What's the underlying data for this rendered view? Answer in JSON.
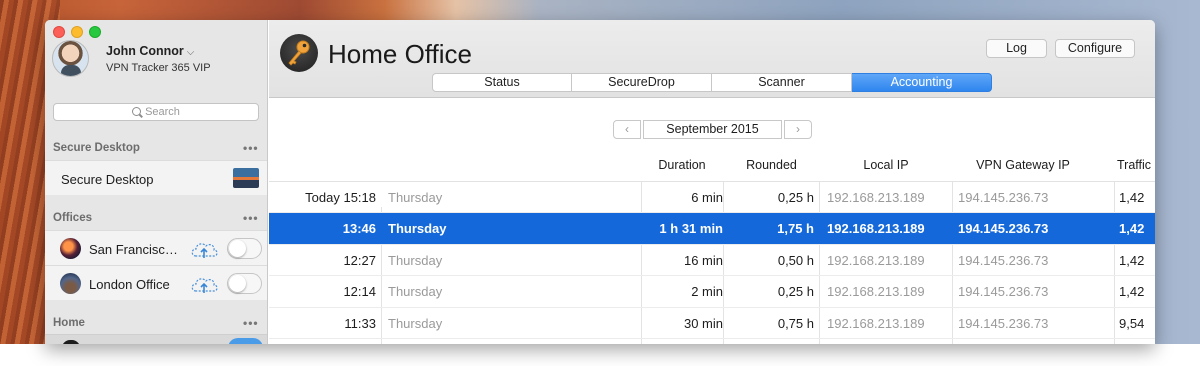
{
  "user": {
    "name": "John Connor",
    "plan": "VPN Tracker 365 VIP"
  },
  "search": {
    "placeholder": "Search"
  },
  "sidebar": {
    "sections": [
      {
        "title": "Secure Desktop",
        "more": "•••",
        "items": [
          {
            "label": "Secure Desktop"
          }
        ]
      },
      {
        "title": "Offices",
        "more": "•••",
        "items": [
          {
            "label": "San Francisc…"
          },
          {
            "label": "London Office"
          }
        ]
      },
      {
        "title": "Home",
        "more": "•••",
        "items": []
      }
    ]
  },
  "app": {
    "title": "Home Office"
  },
  "toolbar": {
    "log_label": "Log",
    "configure_label": "Configure"
  },
  "tabs": [
    {
      "label": "Status",
      "active": false
    },
    {
      "label": "SecureDrop",
      "active": false
    },
    {
      "label": "Scanner",
      "active": false
    },
    {
      "label": "Accounting",
      "active": true
    }
  ],
  "month_nav": {
    "prev": "‹",
    "label": "September 2015",
    "next": "›"
  },
  "table": {
    "columns": [
      "Duration",
      "Rounded",
      "Local IP",
      "VPN Gateway IP",
      "Traffic"
    ],
    "rows": [
      {
        "time": "Today 15:18",
        "day": "Thursday",
        "duration": "6 min",
        "rounded": "0,25 h",
        "local_ip": "192.168.213.189",
        "vpn_ip": "194.145.236.73",
        "traffic": "1,42"
      },
      {
        "time": "13:46",
        "day": "Thursday",
        "duration": "1 h 31 min",
        "rounded": "1,75 h",
        "local_ip": "192.168.213.189",
        "vpn_ip": "194.145.236.73",
        "traffic": "1,42"
      },
      {
        "time": "12:27",
        "day": "Thursday",
        "duration": "16 min",
        "rounded": "0,50 h",
        "local_ip": "192.168.213.189",
        "vpn_ip": "194.145.236.73",
        "traffic": "1,42"
      },
      {
        "time": "12:14",
        "day": "Thursday",
        "duration": "2 min",
        "rounded": "0,25 h",
        "local_ip": "192.168.213.189",
        "vpn_ip": "194.145.236.73",
        "traffic": "1,42"
      },
      {
        "time": "11:33",
        "day": "Thursday",
        "duration": "30 min",
        "rounded": "0,75 h",
        "local_ip": "192.168.213.189",
        "vpn_ip": "194.145.236.73",
        "traffic": "9,54"
      }
    ],
    "selected_row": 1
  },
  "colors": {
    "accent": "#1468d9",
    "tab_active": "#2f86ee"
  }
}
